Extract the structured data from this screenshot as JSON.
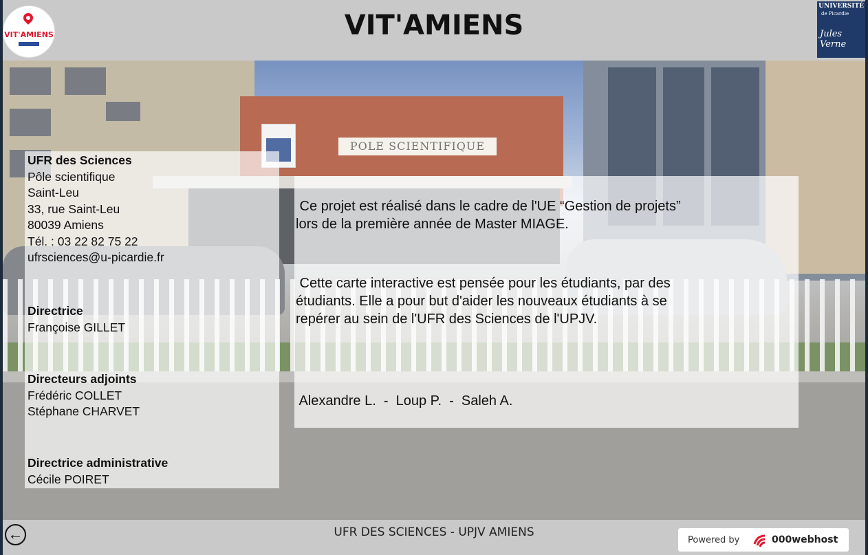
{
  "header": {
    "title": "VIT'AMIENS",
    "logo_left_text": "VIT'AMIENS",
    "logo_right": {
      "university": "UNIVERSITÉ",
      "subtitle": "de Picardie",
      "signature": "Jules Verne"
    }
  },
  "hero": {
    "sign_text": "POLE SCIENTIFIQUE"
  },
  "info": {
    "ufr_title": "UFR des Sciences",
    "address_lines": [
      "Pôle scientifique",
      "Saint-Leu",
      "33, rue Saint-Leu",
      "80039 Amiens",
      "Tél. : 03 22 82 75 22",
      "ufrsciences@u-picardie.fr"
    ],
    "director_heading": "Directrice",
    "director_name": "Françoise GILLET",
    "deputies_heading": "Directeurs adjoints",
    "deputies": [
      "Frédéric COLLET",
      "Stéphane CHARVET"
    ],
    "admin_heading": "Directrice administrative",
    "admin_name": "Cécile POIRET"
  },
  "about": {
    "paragraph1_line1": " Ce projet est réalisé dans le cadre de l'UE “Gestion de projets”",
    "paragraph1_line2": "lors de la première année de Master MIAGE.",
    "paragraph2_line1": " Cette carte interactive est pensée pour les étudiants, par des",
    "paragraph2_line2": "étudiants. Elle a pour but d'aider les nouveaux étudiants à se",
    "paragraph2_line3": "repérer au sein de l'UFR des Sciences de l'UPJV.",
    "authors": " Alexandre L.  -  Loup P.  -  Saleh A."
  },
  "footer": {
    "title": "UFR DES SCIENCES - UPJV AMIENS",
    "back_icon": "arrow-left-circle-icon",
    "powered_label": "Powered by",
    "powered_brand": "000webhost"
  },
  "colors": {
    "frame": "#1d2a3a",
    "bar": "#c9c9c9",
    "logo_red": "#e3172c",
    "univ_blue": "#1f3a68"
  }
}
